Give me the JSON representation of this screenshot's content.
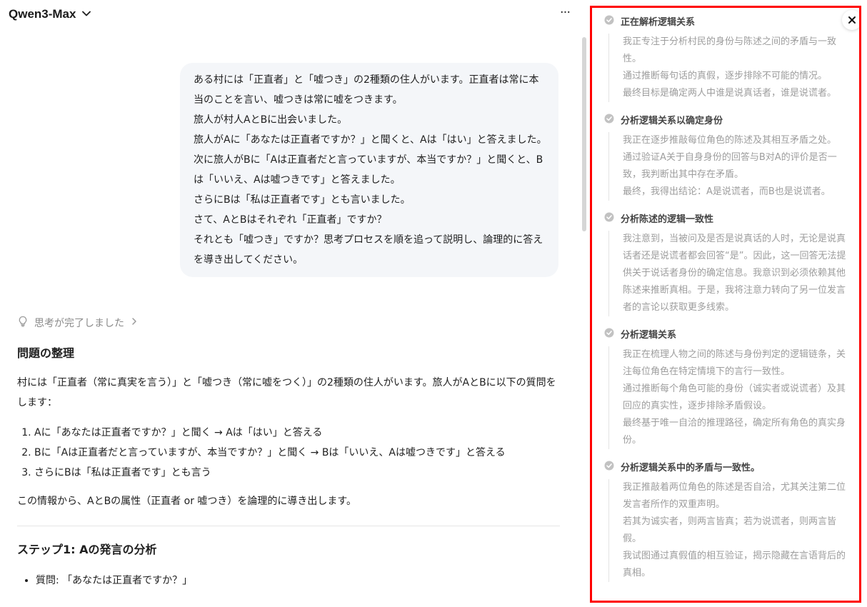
{
  "header": {
    "model_name": "Qwen3-Max",
    "more_label": "···"
  },
  "user_message": {
    "lines": [
      "ある村には「正直者」と「嘘つき」の2種類の住人がいます。正直者は常に本当のことを言い、嘘つきは常に嘘をつきます。",
      "旅人が村人AとBに出会いました。",
      "旅人がAに「あなたは正直者ですか？」と聞くと、Aは「はい」と答えました。",
      "次に旅人がBに「Aは正直者だと言っていますが、本当ですか？」と聞くと、Bは「いいえ、Aは嘘つきです」と答えました。",
      "さらにBは「私は正直者です」とも言いました。",
      "さて、AとBはそれぞれ「正直者」ですか？",
      "それとも「嘘つき」ですか？思考プロセスを順を追って説明し、論理的に答えを導き出してください。"
    ]
  },
  "thinking_status": "思考が完了しました",
  "answer": {
    "heading1": "問題の整理",
    "intro": "村には「正直者（常に真実を言う）」と「嘘つき（常に嘘をつく）」の2種類の住人がいます。旅人がAとBに以下の質問をします：",
    "list": [
      "Aに「あなたは正直者ですか？」と聞く → Aは「はい」と答える",
      "Bに「Aは正直者だと言っていますが、本当ですか？」と聞く → Bは「いいえ、Aは嘘つきです」と答える",
      "さらにBは「私は正直者です」とも言う"
    ],
    "summary": "この情報から、AとBの属性（正直者 or 嘘つき）を論理的に導き出します。",
    "heading2": "ステップ1: Aの発言の分析",
    "bullets": [
      "質問: 「あなたは正直者ですか？」"
    ]
  },
  "panel": {
    "steps": [
      {
        "title": "正在解析逻辑关系",
        "lines": [
          "我正专注于分析村民的身份与陈述之间的矛盾与一致性。",
          "通过推断每句话的真假，逐步排除不可能的情况。",
          "最终目标是确定两人中谁是说真话者，谁是说谎者。"
        ]
      },
      {
        "title": "分析逻辑关系以确定身份",
        "lines": [
          "我正在逐步推敲每位角色的陈述及其相互矛盾之处。",
          "通过验证A关于自身身份的回答与B对A的评价是否一致，我判断出其中存在矛盾。",
          "最终，我得出结论：A是说谎者，而B也是说谎者。"
        ]
      },
      {
        "title": "分析陈述的逻辑一致性",
        "lines": [
          "我注意到，当被问及是否是说真话的人时，无论是说真话者还是说谎者都会回答“是”。因此，这一回答无法提供关于说话者身份的确定信息。我意识到必须依赖其他陈述来推断真相。于是，我将注意力转向了另一位发言者的言论以获取更多线索。"
        ]
      },
      {
        "title": "分析逻辑关系",
        "lines": [
          "我正在梳理人物之间的陈述与身份判定的逻辑链条，关注每位角色在特定情境下的言行一致性。",
          "通过推断每个角色可能的身份（诚实者或说谎者）及其回应的真实性，逐步排除矛盾假设。",
          "最终基于唯一自洽的推理路径，确定所有角色的真实身份。"
        ]
      },
      {
        "title": "分析逻辑关系中的矛盾与一致性。",
        "lines": [
          "我正推敲着两位角色的陈述是否自洽，尤其关注第二位发言者所作的双重声明。",
          "若其为诚实者，则两言皆真；若为说谎者，则两言皆假。",
          "我试图通过真假值的相互验证，揭示隐藏在言语背后的真相。"
        ]
      }
    ]
  },
  "colors": {
    "panel_border": "#ff0000",
    "bubble_bg": "#f4f6f9",
    "muted_text": "#9d9d9d"
  }
}
